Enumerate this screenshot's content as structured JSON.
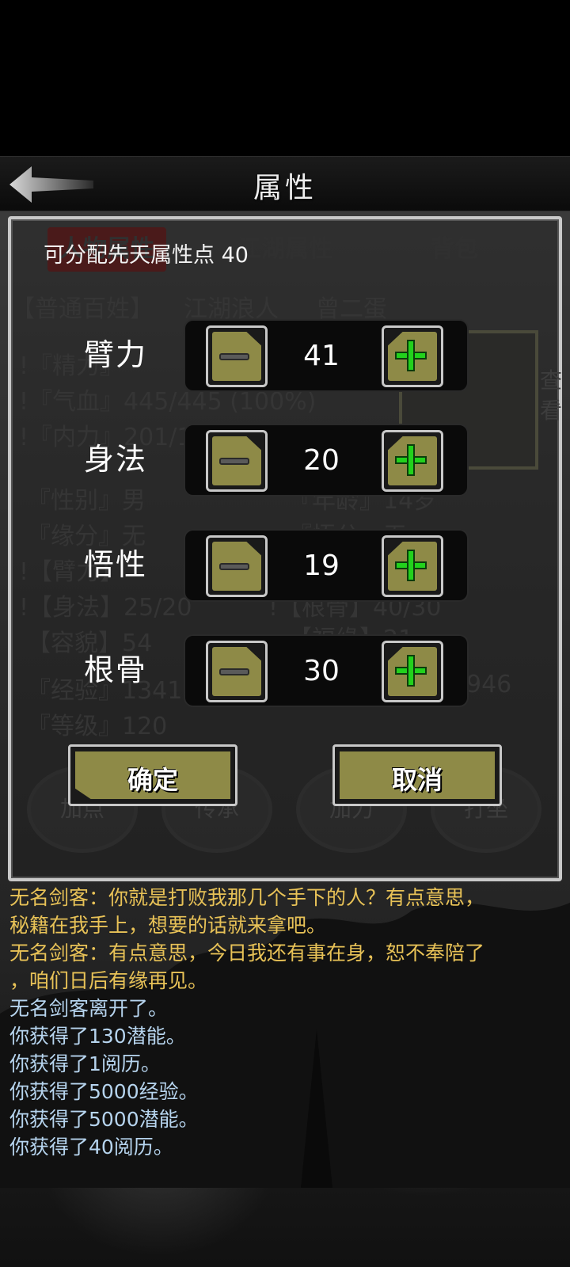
{
  "header": {
    "title": "属性"
  },
  "background": {
    "tabs": [
      "人物属性",
      "江湖属性",
      "背包"
    ],
    "identity": [
      "【普通百姓】",
      "江湖浪人",
      "曾二蛋"
    ],
    "lines": [
      "!『精力』",
      "!『气血』445/445 (100%)",
      "!『内力』201/1250",
      "『性别』男",
      "『缘分』无",
      "!【臂力】",
      "!【身法】25/20",
      "【容貌】54",
      "『经验』13418",
      "『等级』120"
    ],
    "right_lines": [
      "『年龄』14岁",
      "『悟分』无",
      "!【根骨】40/30",
      "【福缘】21",
      "946"
    ],
    "view_label": "查看",
    "round_buttons": [
      "加点",
      "传承",
      "加力",
      "打坐"
    ]
  },
  "dialog": {
    "points_label": "可分配先天属性点 40",
    "stats": [
      {
        "name": "臂力",
        "value": "41"
      },
      {
        "name": "身法",
        "value": "20"
      },
      {
        "name": "悟性",
        "value": "19"
      },
      {
        "name": "根骨",
        "value": "30"
      }
    ],
    "confirm_label": "确定",
    "cancel_label": "取消"
  },
  "log": [
    {
      "text": "无名剑客：你就是打败我那几个手下的人？有点意思，",
      "tone": "gold"
    },
    {
      "text": "秘籍在我手上，想要的话就来拿吧。",
      "tone": "gold"
    },
    {
      "text": "无名剑客：有点意思，今日我还有事在身，恕不奉陪了",
      "tone": "gold"
    },
    {
      "text": "，咱们日后有缘再见。",
      "tone": "gold"
    },
    {
      "text": "无名剑客离开了。",
      "tone": "blue"
    },
    {
      "text": "你获得了130潜能。",
      "tone": "blue"
    },
    {
      "text": "你获得了1阅历。",
      "tone": "blue"
    },
    {
      "text": "你获得了5000经验。",
      "tone": "blue"
    },
    {
      "text": "你获得了5000潜能。",
      "tone": "blue"
    },
    {
      "text": "你获得了40阅历。",
      "tone": "blue"
    }
  ],
  "colors": {
    "button_olive": "#8e8a47",
    "plus_green": "#22d11c",
    "log_gold": "#e8c257",
    "log_blue": "#b6d4ee"
  },
  "icons": {
    "back": "back-arrow-icon",
    "minus": "minus-icon",
    "plus": "plus-icon"
  }
}
